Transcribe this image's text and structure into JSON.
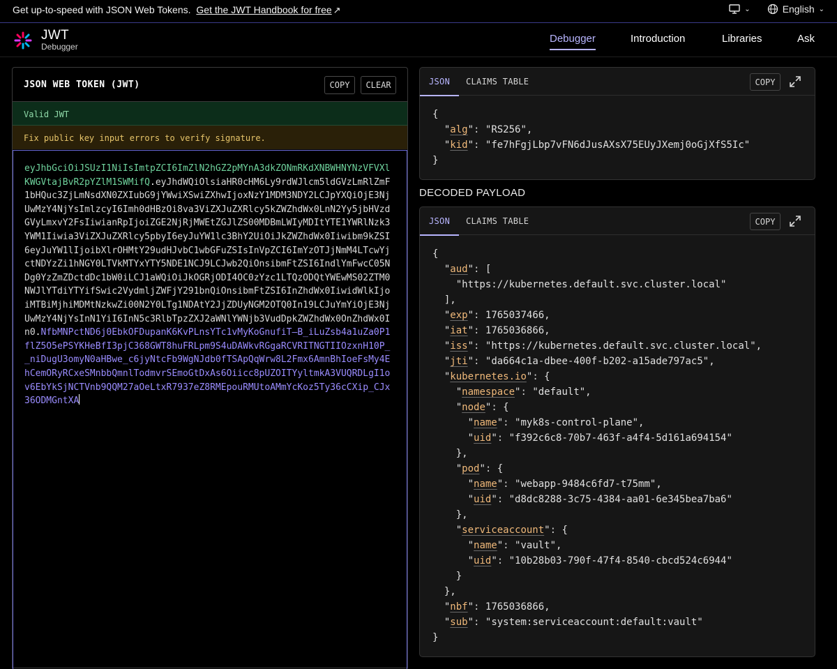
{
  "promo": {
    "message": "Get up-to-speed with JSON Web Tokens.",
    "link": "Get the JWT Handbook for free",
    "language": "English"
  },
  "header": {
    "brand_title": "JWT",
    "brand_subtitle": "Debugger",
    "nav": [
      "Debugger",
      "Introduction",
      "Libraries",
      "Ask"
    ],
    "active_nav": "Debugger"
  },
  "encoded": {
    "title": "JSON WEB TOKEN (JWT)",
    "copy_label": "COPY",
    "clear_label": "CLEAR",
    "valid_message": "Valid JWT",
    "warning_message": "Fix public key input errors to verify signature.",
    "token_header": "eyJhbGciOiJSUzI1NiIsImtpZCI6ImZlN2hGZ2pMYnA3dkZONmRKdXNBWHNYNzVFVXlKWGVtajBvR2pYZlM1SWMifQ",
    "token_payload": "eyJhdWQiOlsiaHR0cHM6Ly9rdWJlcm5ldGVzLmRlZmF1bHQuc3ZjLmNsdXN0ZXIubG9jYWwiXSwiZXhwIjoxNzY1MDM3NDY2LCJpYXQiOjE3NjUwMzY4NjYsImlzcyI6Imh0dHBzOi8va3ViZXJuZXRlcy5kZWZhdWx0LnN2Yy5jbHVzdGVyLmxvY2FsIiwianRpIjoiZGE2NjRjMWEtZGJlZS00MDBmLWIyMDItYTE1YWRlNzk3YWM1Iiwia3ViZXJuZXRlcy5pbyI6eyJuYW1lc3BhY2UiOiJkZWZhdWx0Iiwibm9kZSI6eyJuYW1lIjoibXlrOHMtY29udHJvbC1wbGFuZSIsInVpZCI6ImYzOTJjNmM4LTcwYjctNDYzZi1hNGY0LTVkMTYxYTY5NDE1NCJ9LCJwb2QiOnsibmFtZSI6IndlYmFwcC05NDg0YzZmZDctdDc1bW0iLCJ1aWQiOiJkOGRjODI4OC0zYzc1LTQzODQtYWEwMS02ZTM0NWJlYTdiYTYifSwic2VydmljZWFjY291bnQiOnsibmFtZSI6InZhdWx0IiwidWlkIjoiMTBiMjhiMDMtNzkwZi00N2Y0LTg1NDAtY2JjZDUyNGM2OTQ0In19LCJuYmYiOjE3NjUwMzY4NjYsInN1YiI6InN5c3RlbTpzZXJ2aWNlYWNjb3VudDpkZWZhdWx0OnZhdWx0In0",
    "token_signature": "NfbMNPctND6j0EbkOFDupanK6KvPLnsYTc1vMyKoGnufiT–B_iLuZsb4a1uZa0P1flZ5O5ePSYKHeBfI3pjC368GWT8huFRLpm9S4uDAWkvRGgaRCVRITNGTIIOzxnH10P__niDugU3omyN0aHBwe_c6jyNtcFb9WgNJdb0fTSApQqWrw8L2Fmx6AmnBhIoeFsMy4EhCemORyRCxeSMnbbQmnlTodmvrSEmoGtDxAs6Oiicc8pUZOITYyltmkA3VUQRDLgI1ov6EbYkSjNCTVnb9QQM27aOeLtxR7937eZ8RMEpouRMUtoAMmYcKoz5Ty36cCXip_CJx36ODMGntXA"
  },
  "header_card": {
    "tabs": [
      "JSON",
      "CLAIMS TABLE"
    ],
    "active_tab": "JSON",
    "copy_label": "COPY",
    "lines": [
      "{",
      "  \"alg\": \"RS256\",",
      "  \"kid\": \"fe7hFgjLbp7vFN6dJusAXsX75EUyJXemj0oGjXfS5Ic\"",
      "}"
    ]
  },
  "payload_label": "DECODED PAYLOAD",
  "payload_card": {
    "tabs": [
      "JSON",
      "CLAIMS TABLE"
    ],
    "active_tab": "JSON",
    "copy_label": "COPY",
    "lines": [
      "{",
      "  \"aud\": [",
      "    \"https://kubernetes.default.svc.cluster.local\"",
      "  ],",
      "  \"exp\": 1765037466,",
      "  \"iat\": 1765036866,",
      "  \"iss\": \"https://kubernetes.default.svc.cluster.local\",",
      "  \"jti\": \"da664c1a-dbee-400f-b202-a15ade797ac5\",",
      "  \"kubernetes.io\": {",
      "    \"namespace\": \"default\",",
      "    \"node\": {",
      "      \"name\": \"myk8s-control-plane\",",
      "      \"uid\": \"f392c6c8-70b7-463f-a4f4-5d161a694154\"",
      "    },",
      "    \"pod\": {",
      "      \"name\": \"webapp-9484c6fd7-t75mm\",",
      "      \"uid\": \"d8dc8288-3c75-4384-aa01-6e345bea7ba6\"",
      "    },",
      "    \"serviceaccount\": {",
      "      \"name\": \"vault\",",
      "      \"uid\": \"10b28b03-790f-47f4-8540-cbcd524c6944\"",
      "    }",
      "  },",
      "  \"nbf\": 1765036866,",
      "  \"sub\": \"system:serviceaccount:default:vault\"",
      "}"
    ]
  },
  "colors": {
    "accent": "#b8b5ff",
    "token_header": "#6fd39d",
    "token_signature": "#9a8cff",
    "json_key": "#f0b97a"
  }
}
